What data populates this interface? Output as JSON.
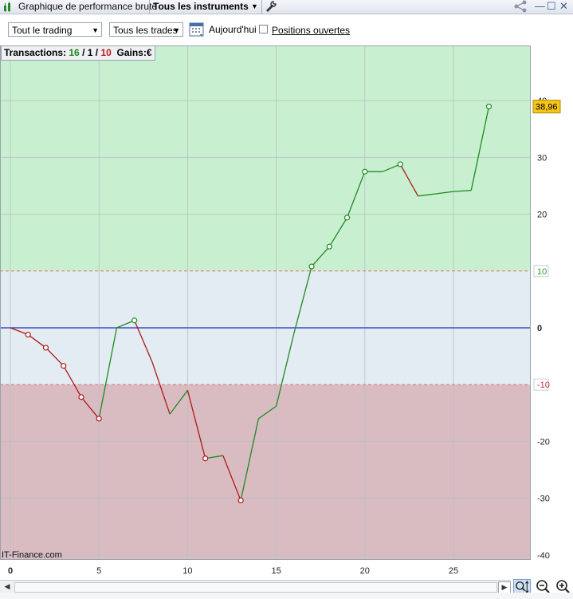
{
  "titlebar": {
    "title": "Graphique de performance brute",
    "instrument": "Tous les instruments"
  },
  "toolbar": {
    "scope_select": "Tout le trading",
    "trades_select": "Tous les trades",
    "today_label": "Aujourd'hui",
    "positions_label": "Positions ouvertes",
    "positions_checked": false
  },
  "summary": {
    "transactions_label": "Transactions:",
    "winning": "16",
    "separator1": " / ",
    "even": "1",
    "separator2": " / ",
    "losing": "10",
    "gains_label": "Gains:",
    "currency": "€"
  },
  "watermark": "IT-Finance.com",
  "colors": {
    "gain_zone": "#c8f0d0",
    "neutral_zone": "#e2ecf2",
    "loss_zone": "#d8bcc2",
    "up_line": "#1f8a1f",
    "down_line": "#b01818",
    "zero_line": "#2030c0",
    "last_value_bg": "#f5c518"
  },
  "chart_data": {
    "type": "line",
    "title": "",
    "xlabel": "",
    "ylabel": "",
    "xlim": [
      0,
      29
    ],
    "ylim": [
      -42,
      50
    ],
    "x_ticks": [
      0,
      5,
      10,
      15,
      20,
      25
    ],
    "y_ticks": [
      -40,
      -30,
      -20,
      -10,
      0,
      10,
      20,
      30,
      40
    ],
    "y_tick_labels": [
      "-40",
      "-30",
      "-20",
      "-10",
      "0",
      "10",
      "20",
      "30",
      "40"
    ],
    "threshold_upper": 10,
    "threshold_lower": -10,
    "grid": true,
    "last_value_label": "38,96",
    "series": [
      {
        "x": [
          0,
          1,
          2,
          3,
          4,
          5,
          6,
          7,
          8,
          9,
          10,
          11,
          12,
          13,
          14,
          15,
          16,
          17,
          18,
          19,
          20,
          21,
          22,
          23,
          24,
          25,
          26,
          27
        ],
        "values": [
          0,
          -1.2,
          -3.5,
          -6.7,
          -12.2,
          -16.0,
          0,
          1.3,
          -6.0,
          -15.2,
          -11.0,
          -23.0,
          -22.5,
          -30.4,
          -16.0,
          -13.8,
          -1.0,
          10.8,
          14.3,
          19.4,
          27.5,
          27.5,
          28.8,
          23.2,
          23.6,
          24.0,
          24.2,
          38.96
        ],
        "markers": [
          1,
          2,
          3,
          4,
          5,
          7,
          11,
          13,
          17,
          18,
          19,
          20,
          22,
          27
        ]
      }
    ]
  },
  "bottom": {
    "scroll_left": "◀",
    "scroll_right": "▶"
  }
}
